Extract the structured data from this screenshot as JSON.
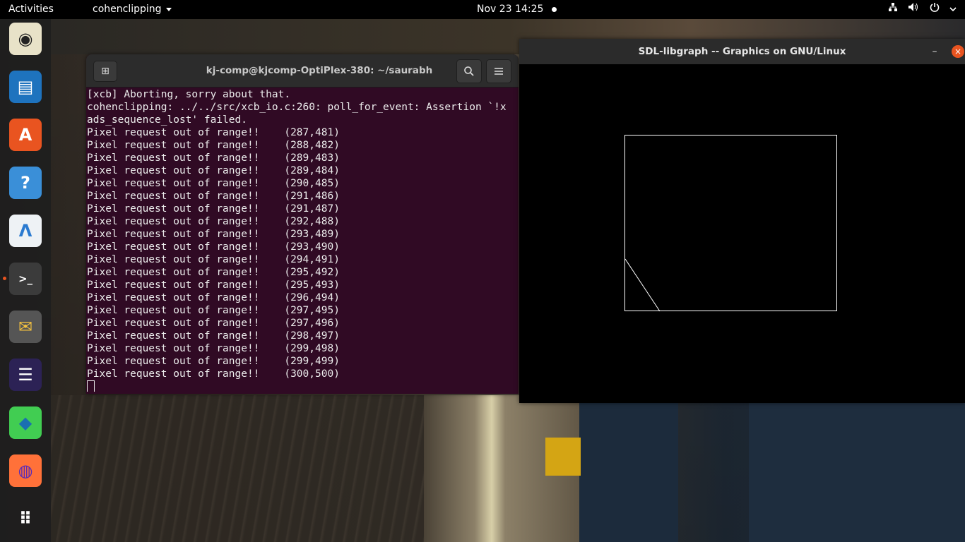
{
  "topbar": {
    "activities": "Activities",
    "app_menu": "cohenclipping",
    "clock": "Nov 23  14:25",
    "tray_icons": [
      "network-icon",
      "volume-icon",
      "power-icon",
      "chevron-down-icon"
    ]
  },
  "dock": {
    "items": [
      {
        "name": "rhythmbox-icon",
        "glyph": "◉",
        "bg": "#e8e2c8",
        "fg": "#222"
      },
      {
        "name": "libreoffice-writer-icon",
        "glyph": "▤",
        "bg": "#1e73be",
        "fg": "#fff"
      },
      {
        "name": "ubuntu-software-icon",
        "glyph": "A",
        "bg": "#e95420",
        "fg": "#fff"
      },
      {
        "name": "help-icon",
        "glyph": "?",
        "bg": "#3a8fd8",
        "fg": "#fff"
      },
      {
        "name": "android-studio-icon",
        "glyph": "Λ",
        "bg": "#eef2f5",
        "fg": "#2a7ad0"
      },
      {
        "name": "terminal-icon",
        "glyph": ">_",
        "bg": "#3b3b3b",
        "fg": "#fff"
      },
      {
        "name": "email-search-icon",
        "glyph": "✉",
        "bg": "#555",
        "fg": "#f2c040"
      },
      {
        "name": "eclipse-icon",
        "glyph": "☰",
        "bg": "#2c2255",
        "fg": "#fff"
      },
      {
        "name": "qtcreator-icon",
        "glyph": "◆",
        "bg": "#41cd52",
        "fg": "#1a6fb0"
      },
      {
        "name": "firefox-icon",
        "glyph": "◍",
        "bg": "#ff7139",
        "fg": "#5a2cb8"
      },
      {
        "name": "show-apps-icon",
        "glyph": "⠿",
        "bg": "transparent",
        "fg": "#fff"
      }
    ]
  },
  "terminal": {
    "title": "kj-comp@kjcomp-OptiPlex-380: ~/saurabh",
    "new_tab_glyph": "⊞",
    "search_glyph": "⌕",
    "menu_glyph": "☰",
    "lines": [
      "[xcb] Aborting, sorry about that.",
      "cohenclipping: ../../src/xcb_io.c:260: poll_for_event: Assertion `!x",
      "ads_sequence_lost' failed.",
      "Pixel request out of range!!    (287,481)",
      "Pixel request out of range!!    (288,482)",
      "Pixel request out of range!!    (289,483)",
      "Pixel request out of range!!    (289,484)",
      "Pixel request out of range!!    (290,485)",
      "Pixel request out of range!!    (291,486)",
      "Pixel request out of range!!    (291,487)",
      "Pixel request out of range!!    (292,488)",
      "Pixel request out of range!!    (293,489)",
      "Pixel request out of range!!    (293,490)",
      "Pixel request out of range!!    (294,491)",
      "Pixel request out of range!!    (295,492)",
      "Pixel request out of range!!    (295,493)",
      "Pixel request out of range!!    (296,494)",
      "Pixel request out of range!!    (297,495)",
      "Pixel request out of range!!    (297,496)",
      "Pixel request out of range!!    (298,497)",
      "Pixel request out of range!!    (299,498)",
      "Pixel request out of range!!    (299,499)",
      "Pixel request out of range!!    (300,500)"
    ]
  },
  "sdl": {
    "title": "SDL-libgraph -- Graphics on GNU/Linux",
    "minimize_glyph": "–",
    "close_glyph": "×"
  },
  "colors": {
    "terminal_bg": "#300a24",
    "accent": "#e95420"
  }
}
